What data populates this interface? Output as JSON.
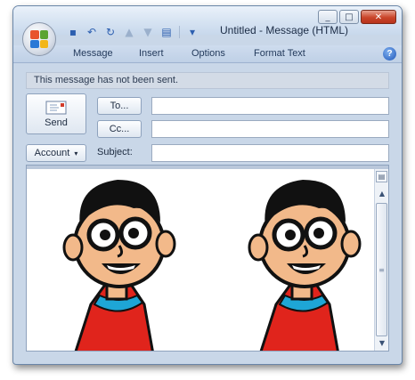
{
  "window": {
    "title": "Untitled - Message (HTML)",
    "caption_buttons": {
      "minimize": "_",
      "maximize": "□",
      "close": "✕"
    }
  },
  "orb": {
    "icon": "office-orb-icon",
    "colors": [
      "#e8542d",
      "#5ba431",
      "#2a78d6",
      "#f2b619"
    ]
  },
  "quick_access": [
    {
      "icon": "save-icon",
      "glyph": "▪"
    },
    {
      "icon": "undo-icon",
      "glyph": "↶"
    },
    {
      "icon": "redo-icon",
      "glyph": "↻"
    },
    {
      "icon": "previous-item-icon",
      "glyph": "▲"
    },
    {
      "icon": "next-item-icon",
      "glyph": "▼"
    },
    {
      "icon": "form-icon",
      "glyph": "▤"
    },
    {
      "icon": "customize-dropdown-icon",
      "glyph": "▾"
    }
  ],
  "ribbon": {
    "tabs": [
      "Message",
      "Insert",
      "Options",
      "Format Text"
    ],
    "help_label": "?"
  },
  "infobar": {
    "text": "This message has not been sent."
  },
  "header": {
    "send_label": "Send",
    "to_label": "To...",
    "cc_label": "Cc...",
    "account_label": "Account",
    "subject_label": "Subject:",
    "to_value": "",
    "cc_value": "",
    "subject_value": ""
  },
  "body": {
    "images": [
      {
        "name": "cartoon-boy-image-1"
      },
      {
        "name": "cartoon-boy-image-2"
      }
    ]
  },
  "colors": {
    "accent": "#2d5fb0",
    "skin": "#f2b98a",
    "hair": "#111111",
    "shirt": "#e0241c",
    "collar": "#1ea6d6"
  }
}
